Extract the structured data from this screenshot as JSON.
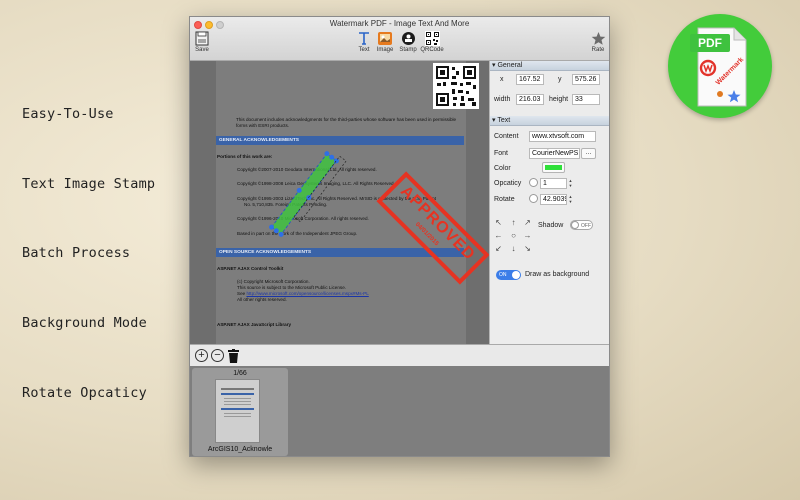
{
  "features": [
    "Easy-To-Use",
    "Text Image Stamp",
    "Batch Process",
    "Background Mode",
    "Rotate Opcaticy"
  ],
  "window": {
    "title": "Watermark PDF - Image Text And More",
    "toolbar": {
      "save": "Save",
      "text": "Text",
      "image": "Image",
      "stamp": "Stamp",
      "qrcode": "QRCode",
      "rate": "Rate"
    }
  },
  "document": {
    "intro": "This document includes acknowledgments for the third-parties whose software has been used in permissible forms with ESRI products.",
    "section1": "GENERAL ACKNOWLEDGEMENTS",
    "portions": "Portions of this work are:",
    "c1": "Copyright ©2007-2010 Geodata International Ltd. All rights reserved.",
    "c2": "Copyright ©1998-2008 Leica Geosystems Imaging, LLC. All Rights Reserved",
    "c3a": "Copyright ©1995-2003 LizardTech Inc. All Rights Reserved. MrSID is protected by the U.S. Patent",
    "c3b": "No. 5,710,835. Foreign Patents Pending.",
    "c4": "Copyright ©1996-2010 Microsoft Corporation. All rights reserved.",
    "c5": "Based in part on the work of the Independent JPEG Group.",
    "section2": "OPEN SOURCE ACKNOWLEDGEMENTS",
    "aspnet": "ASP.NET AJAX Control Toolkit",
    "ms1": "(c) Copyright Microsoft Corporation.",
    "ms2": "This source is subject to the Microsoft Public License.",
    "see": "See",
    "link": "http://www.microsoft.com/opensource/licenses.mspx#Ms-PL",
    "ms4": "All other rights reserved.",
    "aspjs": "ASP.NET AJAX JavaScript Library",
    "stamp_big": "APPROVED",
    "stamp_small": "04/01/2015"
  },
  "panel": {
    "general": {
      "header": "General",
      "x_label": "x",
      "x_value": "167.52",
      "y_label": "y",
      "y_value": "575.26",
      "width_label": "width",
      "width_value": "216.03",
      "height_label": "height",
      "height_value": "33"
    },
    "text": {
      "header": "Text",
      "content_label": "Content",
      "content_value": "www.xtvsoft.com",
      "font_label": "Font",
      "font_value": "CourierNewPS",
      "font_button": "...",
      "color_label": "Color",
      "color_value": "#2fe03a",
      "opacity_label": "Opcaticy",
      "opacity_value": "1",
      "rotate_label": "Rotate",
      "rotate_value": "42.9039",
      "shadow_label": "Shadow",
      "shadow_toggle": "OFF",
      "bg_toggle": "ON",
      "bg_label": "Draw as background"
    }
  },
  "bottom": {
    "add": "+",
    "remove": "−",
    "page_count": "1/66",
    "thumb_name": "ArcGIS10_Acknowle"
  },
  "badge": {
    "label": "PDF",
    "stamp_text": "Watermark"
  },
  "colors": {
    "accent": "#3b7de8",
    "stamp": "#e63322",
    "badge": "#43cc3b"
  }
}
